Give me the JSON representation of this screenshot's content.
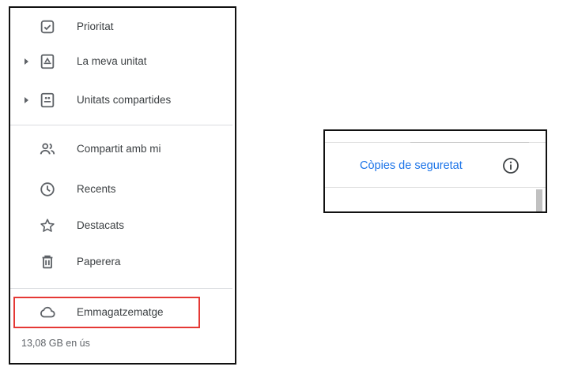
{
  "sidebar": {
    "items": [
      {
        "label": "Prioritat",
        "icon": "priority-check-icon"
      },
      {
        "label": "La meva unitat",
        "icon": "my-drive-icon",
        "expandable": true
      },
      {
        "label": "Unitats compartides",
        "icon": "shared-drives-icon",
        "expandable": true
      },
      {
        "label": "Compartit amb mi",
        "icon": "people-icon"
      },
      {
        "label": "Recents",
        "icon": "clock-icon"
      },
      {
        "label": "Destacats",
        "icon": "star-icon"
      },
      {
        "label": "Paperera",
        "icon": "trash-icon"
      },
      {
        "label": "Emmagatzematge",
        "icon": "cloud-icon",
        "highlighted": true
      }
    ],
    "storage_usage": "13,08 GB en ús"
  },
  "backups_panel": {
    "link_label": "Còpies de seguretat",
    "icon": "info-icon"
  },
  "colors": {
    "link": "#1a73e8",
    "highlight_border": "#e53935",
    "text": "#3c4043"
  }
}
